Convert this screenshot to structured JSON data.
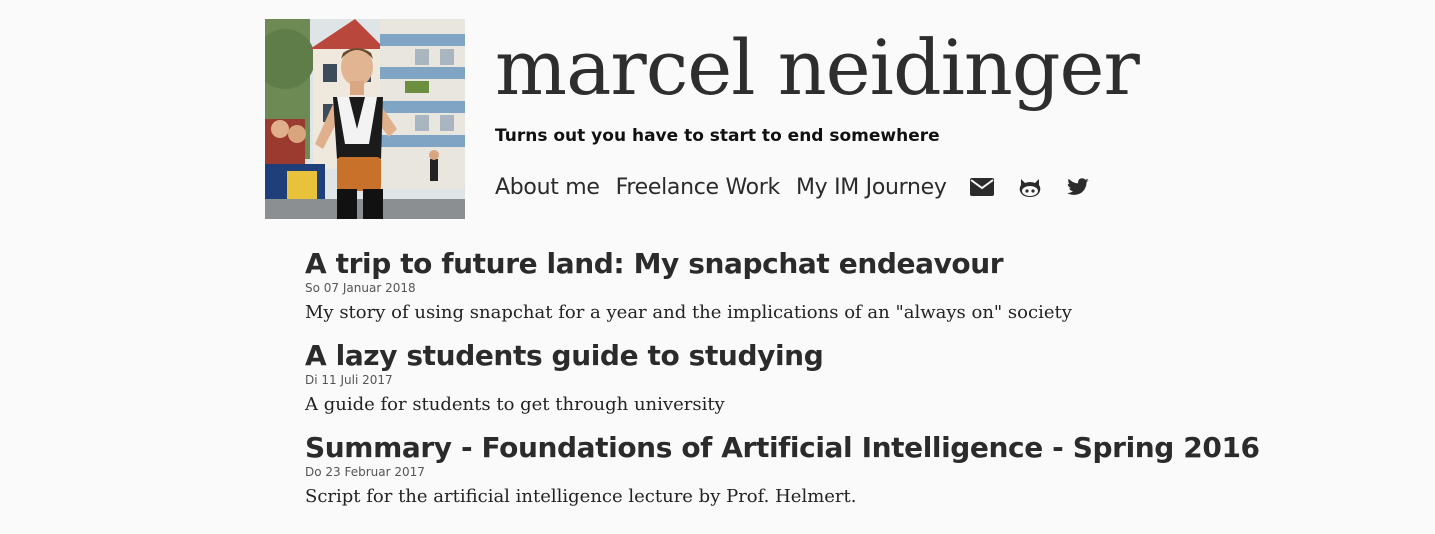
{
  "header": {
    "name_first": "marcel",
    "name_last": "neidinger",
    "tagline": "Turns out you have to start to end somewhere"
  },
  "nav": {
    "items": [
      {
        "label": "About me"
      },
      {
        "label": "Freelance Work"
      },
      {
        "label": "My IM Journey"
      }
    ],
    "icons": [
      "envelope-icon",
      "github-icon",
      "twitter-icon"
    ]
  },
  "posts": [
    {
      "title": "A trip to future land: My snapchat endeavour",
      "date": "So 07 Januar 2018",
      "summary": "My story of using snapchat for a year and the implications of an \"always on\" society"
    },
    {
      "title": "A lazy students guide to studying",
      "date": "Di 11 Juli 2017",
      "summary": "A guide for students to get through university"
    },
    {
      "title": "Summary - Foundations of Artificial Intelligence - Spring 2016",
      "date": "Do 23 Februar 2017",
      "summary": "Script for the artificial intelligence lecture by Prof. Helmert."
    }
  ],
  "colors": {
    "background": "#fafafa",
    "text": "#2b2b2b"
  }
}
